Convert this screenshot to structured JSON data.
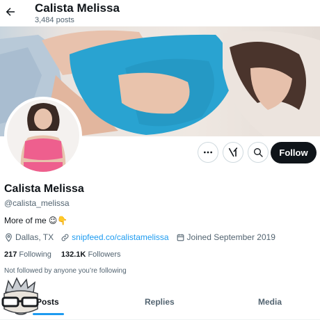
{
  "header": {
    "back_icon": "arrow-left-icon",
    "name": "Calista Melissa",
    "posts_count": "3,484 posts"
  },
  "profile": {
    "display_name": "Calista Melissa",
    "handle": "@calista_melissa",
    "bio_text": "More of me",
    "bio_emojis": "😉👇",
    "location": "Dallas, TX",
    "website": "snipfeed.co/calistamelissa",
    "joined": "Joined September 2019"
  },
  "actions": {
    "more_icon": "more-icon",
    "grok_icon": "grok-icon",
    "search_icon": "search-icon",
    "follow_label": "Follow"
  },
  "stats": {
    "following_count": "217",
    "following_label": "Following",
    "followers_count": "132.1K",
    "followers_label": "Followers"
  },
  "not_followed_text": "Not followed by anyone you’re following",
  "tabs": [
    {
      "label": "Posts",
      "active": true
    },
    {
      "label": "Replies",
      "active": false
    },
    {
      "label": "Media",
      "active": false
    }
  ],
  "colors": {
    "accent": "#1d9bf0",
    "text": "#0f1419",
    "muted": "#536471",
    "top_blue": "#29a3d1",
    "top_pink": "#ee5f8e"
  }
}
